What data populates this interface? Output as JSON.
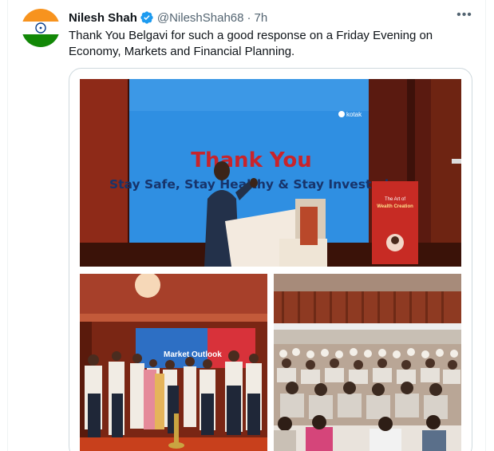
{
  "author": {
    "name": "Nilesh Shah",
    "handle": "@NileshShah68",
    "separator": "·",
    "time": "7h",
    "avatar_icon": "india-flag-avatar",
    "verified_icon": "verified-badge-icon"
  },
  "more_label": "•••",
  "tweet_text": "Thank You Belgavi for such a good response on a Friday Evening on Economy, Markets and Financial Planning.",
  "photos": {
    "main": {
      "screen_title": "Thank You",
      "screen_subtitle": "Stay Safe, Stay Healthy & Stay Invested",
      "logo": "kotak",
      "banner_title_line1": "The Art of",
      "banner_title_line2": "Wealth Creation"
    },
    "left": {
      "screen_text": "Market Outlook"
    },
    "right": {}
  },
  "colors": {
    "text_primary": "#0f1419",
    "text_secondary": "#536471",
    "verified_blue": "#1d9bf0",
    "border": "#cfd9de",
    "slide_blue": "#1f8fe0",
    "thank_you_red": "#c8242b",
    "banner_red": "#c72b24"
  }
}
